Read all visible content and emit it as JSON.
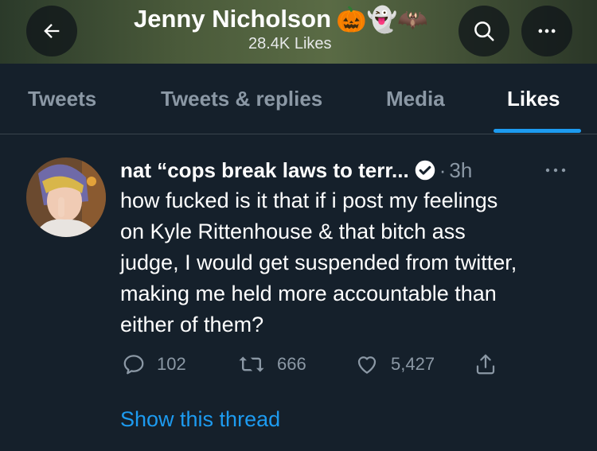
{
  "header": {
    "title": "Jenny Nicholson",
    "title_emojis": "🎃👻🦇",
    "subtitle": "28.4K Likes",
    "back_icon": "arrow-left-icon",
    "search_icon": "search-icon",
    "more_icon": "more-horizontal-icon"
  },
  "tabs": [
    {
      "label": "Tweets",
      "active": false
    },
    {
      "label": "Tweets & replies",
      "active": false
    },
    {
      "label": "Media",
      "active": false
    },
    {
      "label": "Likes",
      "active": true
    }
  ],
  "tweet": {
    "author": "nat “cops break laws to terr...",
    "verified_icon": "verified-badge-icon",
    "separator": "·",
    "time": "3h",
    "text": "how fucked is it that if i post my feelings\non Kyle Rittenhouse & that bitch ass\njudge, I would get suspended from twitter,\nmaking me held more accountable than\neither of them?",
    "actions": {
      "replies": "102",
      "retweets": "666",
      "likes": "5,427"
    },
    "show_thread": "Show this thread"
  },
  "colors": {
    "background": "#15202b",
    "accent": "#1d9bf0",
    "muted": "#8b98a5",
    "border": "#38444d"
  }
}
